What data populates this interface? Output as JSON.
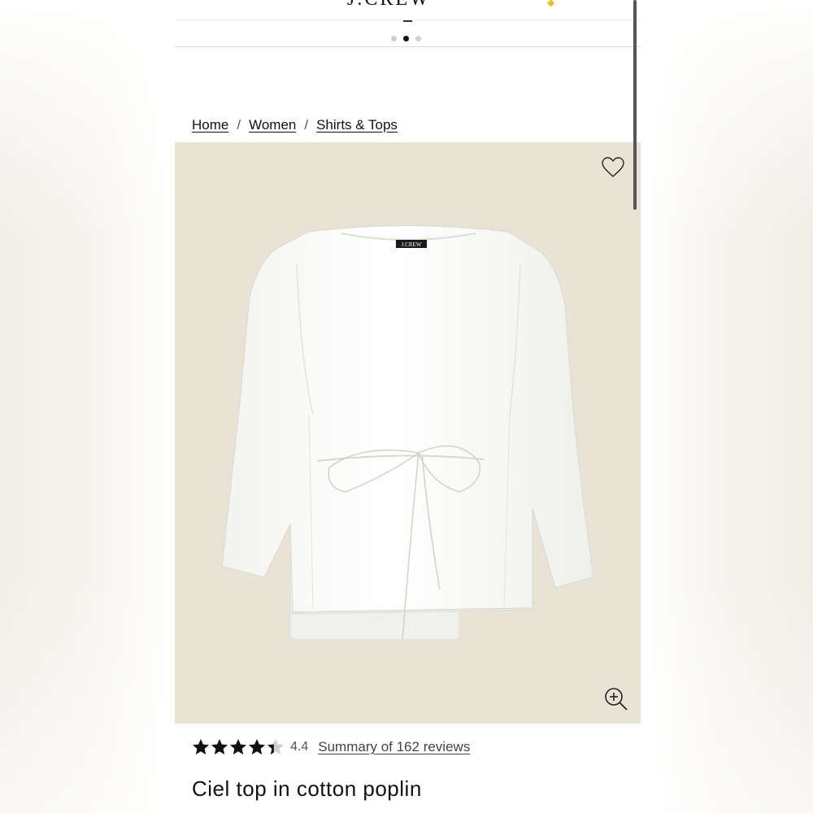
{
  "header": {
    "logo_text": "J.CREW",
    "carousel": {
      "total": 3,
      "active_index": 2
    }
  },
  "breadcrumb": {
    "items": [
      "Home",
      "Women",
      "Shirts & Tops"
    ],
    "separator": "/"
  },
  "hero": {
    "background_color": "#e9e3d6",
    "tag_text": "J.CREW",
    "icons": {
      "favorite": "heart-outline-icon",
      "zoom": "zoom-in-icon"
    }
  },
  "product": {
    "rating": 4.4,
    "rating_label": "4.4",
    "stars_filled": 4.4,
    "reviews_link": "Summary of 162 reviews",
    "title": "Ciel top in cotton poplin"
  }
}
